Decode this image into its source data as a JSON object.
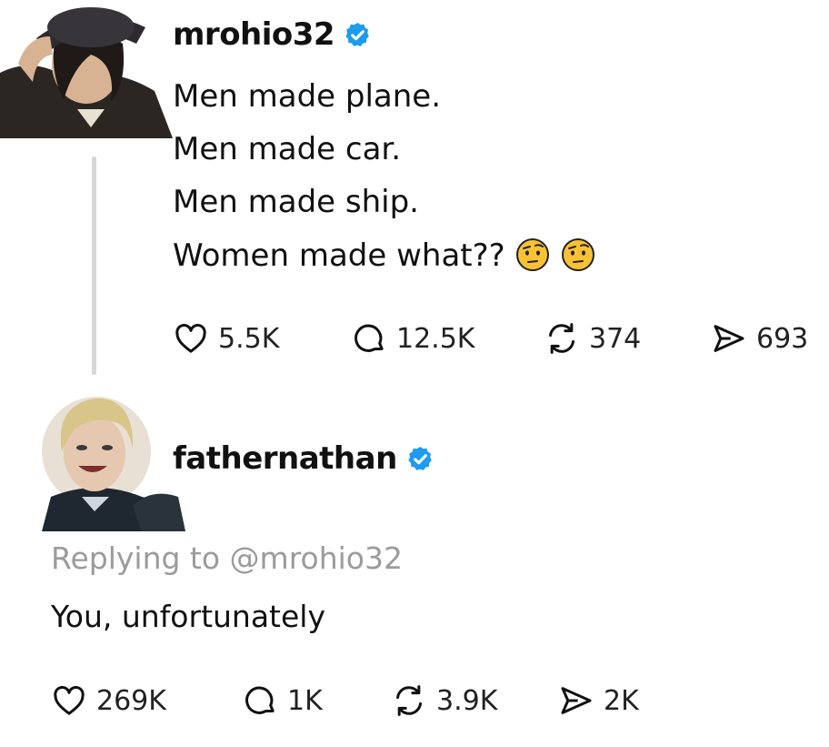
{
  "post": {
    "username": "mrohio32",
    "lines": [
      "Men made plane.",
      "Men made car.",
      "Men made ship.",
      "Women made what??"
    ],
    "emoji_icons": [
      "raised-eyebrow-emoji",
      "raised-eyebrow-emoji"
    ],
    "actions": {
      "likes": "5.5K",
      "comments": "12.5K",
      "reposts": "374",
      "shares": "693"
    }
  },
  "reply": {
    "username": "fathernathan",
    "replying_prefix": "Replying to",
    "replying_handle": "@mrohio32",
    "text": "You, unfortunately",
    "actions": {
      "likes": "269K",
      "comments": "1K",
      "reposts": "3.9K",
      "shares": "2K"
    }
  },
  "colors": {
    "verified": "#1d9bf0",
    "muted": "#9b9b9b",
    "thread_line": "#d7d7d7",
    "emoji": "#f9c235"
  },
  "icons": [
    "heart-icon",
    "comment-icon",
    "repost-icon",
    "share-icon",
    "verified-badge-icon"
  ]
}
